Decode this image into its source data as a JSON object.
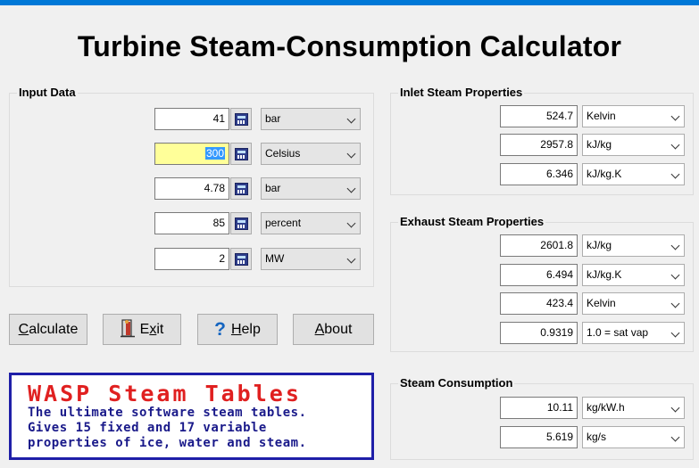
{
  "title": "Turbine Steam-Consumption Calculator",
  "accent_color": "#0078d7",
  "input_data": {
    "label": "Input Data",
    "rows": [
      {
        "value": "41",
        "unit": "bar",
        "icon": "calculator-icon"
      },
      {
        "value_selected": "300",
        "unit": "Celsius",
        "icon": "calculator-icon"
      },
      {
        "value": "4.78",
        "unit": "bar",
        "icon": "calculator-icon"
      },
      {
        "value": "85",
        "unit": "percent",
        "icon": "calculator-icon"
      },
      {
        "value": "2",
        "unit": "MW",
        "icon": "calculator-icon"
      }
    ]
  },
  "inlet": {
    "label": "Inlet Steam Properties",
    "rows": [
      {
        "value": "524.7",
        "unit": "Kelvin"
      },
      {
        "value": "2957.8",
        "unit": "kJ/kg"
      },
      {
        "value": "6.346",
        "unit": "kJ/kg.K"
      }
    ]
  },
  "exhaust": {
    "label": "Exhaust Steam Properties",
    "rows": [
      {
        "value": "2601.8",
        "unit": "kJ/kg"
      },
      {
        "value": "6.494",
        "unit": "kJ/kg.K"
      },
      {
        "value": "423.4",
        "unit": "Kelvin"
      },
      {
        "value": "0.9319",
        "unit": "1.0 = sat vap"
      }
    ]
  },
  "consumption": {
    "label": "Steam Consumption",
    "rows": [
      {
        "value": "10.11",
        "unit": "kg/kW.h"
      },
      {
        "value": "5.619",
        "unit": "kg/s"
      }
    ]
  },
  "buttons": {
    "calculate_mn": "C",
    "calculate_rest": "alculate",
    "exit_pre": "E",
    "exit_mn": "x",
    "exit_rest": "it",
    "help_mn": "H",
    "help_rest": "elp",
    "about_mn": "A",
    "about_rest": "bout"
  },
  "banner": {
    "title": "WASP Steam Tables",
    "line1": "The ultimate software steam tables.",
    "line2": "Gives 15 fixed and 17 variable",
    "line3": "properties of ice, water and steam."
  }
}
